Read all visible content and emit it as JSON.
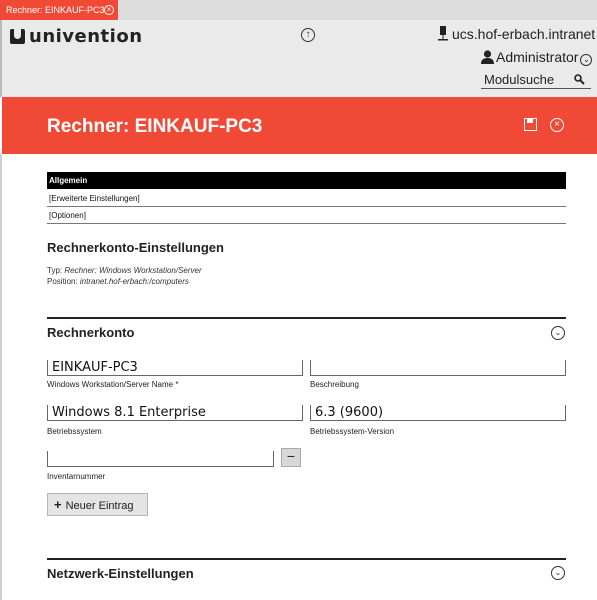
{
  "tab": {
    "label": "Rechner: EINKAUF-PC3",
    "close_glyph": "×"
  },
  "header": {
    "brand": "univention",
    "hostname": "ucs.hof-erbach.intranet",
    "user": "Administrator",
    "search_label": "Modulsuche",
    "nav_up_glyph": "↑",
    "chevron_glyph": "⌄"
  },
  "titlebar": {
    "title": "Rechner: EINKAUF-PC3",
    "close_glyph": "×"
  },
  "subtabs": [
    "Allgemein",
    "[Erweiterte Einstellungen]",
    "[Optionen]"
  ],
  "settings": {
    "title": "Rechnerkonto-Einstellungen",
    "type_label": "Typ: ",
    "type_value": "Rechner: Windows Workstation/Server",
    "position_label": "Position: ",
    "position_value": "intranet.hof-erbach:/computers"
  },
  "rechnerkonto": {
    "title": "Rechnerkonto",
    "toggle_glyph": "⌄",
    "name_value": "EINKAUF-PC3",
    "name_label": "Windows Workstation/Server Name *",
    "description_value": "",
    "description_label": "Beschreibung",
    "os_value": "Windows 8.1 Enterprise",
    "os_label": "Betriebssystem",
    "os_version_value": "6.3 (9600)",
    "os_version_label": "Betriebssystem-Version",
    "inventory_value": "",
    "inventory_label": "Inventarnummer",
    "remove_glyph": "−",
    "add_plus": "+",
    "add_label": "Neuer Eintrag"
  },
  "network": {
    "title": "Netzwerk-Einstellungen",
    "toggle_glyph": "⌄"
  },
  "colors": {
    "accent": "#f04a36",
    "header_bg": "#eaeaea",
    "tabbar_bg": "#dcdcdc"
  },
  "icons": [
    "close-icon",
    "logo-icon",
    "arrow-up-icon",
    "network-icon",
    "user-icon",
    "chevron-down-icon",
    "search-icon",
    "save-icon"
  ]
}
